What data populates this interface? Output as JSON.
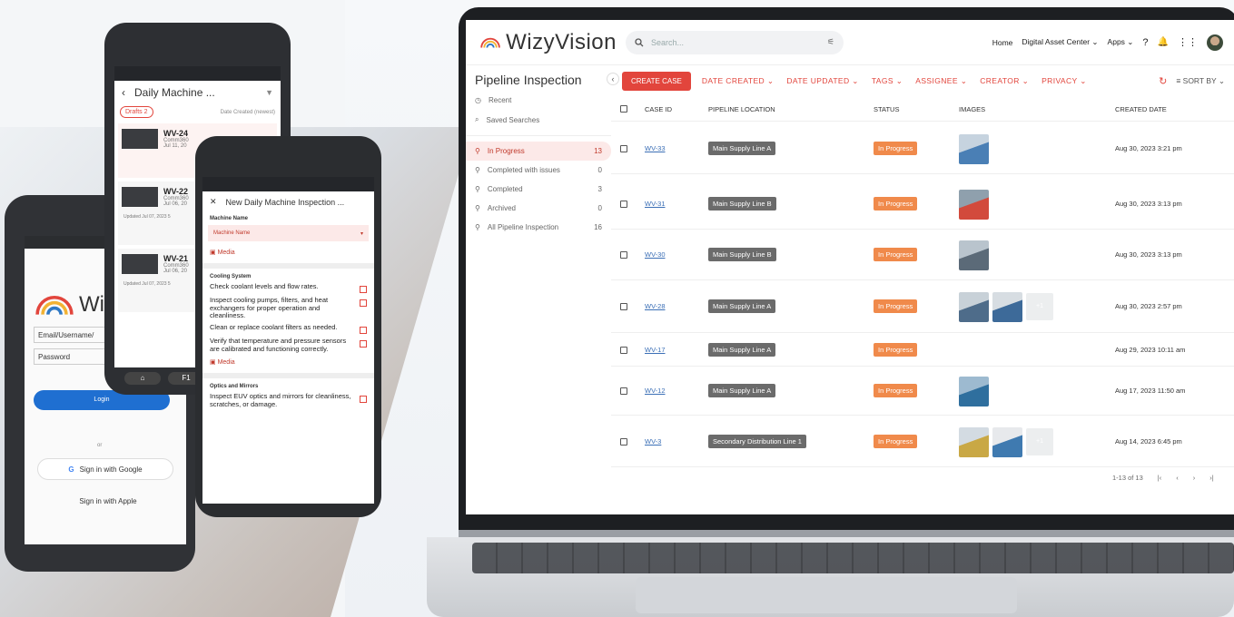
{
  "brand": {
    "name": "WizyVision"
  },
  "header": {
    "search_placeholder": "Search...",
    "nav": [
      "Home",
      "Digital Asset Center",
      "Apps"
    ]
  },
  "sidebar": {
    "title": "Pipeline Inspection",
    "links": [
      {
        "label": "Recent"
      },
      {
        "label": "Saved Searches"
      }
    ],
    "items": [
      {
        "label": "In Progress",
        "count": "13",
        "active": true
      },
      {
        "label": "Completed with issues",
        "count": "0"
      },
      {
        "label": "Completed",
        "count": "3"
      },
      {
        "label": "Archived",
        "count": "0"
      },
      {
        "label": "All Pipeline Inspection",
        "count": "16"
      }
    ]
  },
  "toolbar": {
    "create": "CREATE CASE",
    "filters": [
      "DATE CREATED",
      "DATE UPDATED",
      "TAGS",
      "ASSIGNEE",
      "CREATOR",
      "PRIVACY"
    ],
    "sort": "SORT BY"
  },
  "table": {
    "headers": [
      "CASE ID",
      "PIPELINE LOCATION",
      "STATUS",
      "IMAGES",
      "CREATED DATE"
    ],
    "rows": [
      {
        "id": "WV-33",
        "loc": "Main Supply Line A",
        "status": "In Progress",
        "date": "Aug 30, 2023 3:21 pm"
      },
      {
        "id": "WV-31",
        "loc": "Main Supply Line B",
        "status": "In Progress",
        "date": "Aug 30, 2023 3:13 pm"
      },
      {
        "id": "WV-30",
        "loc": "Main Supply Line B",
        "status": "In Progress",
        "date": "Aug 30, 2023 3:13 pm"
      },
      {
        "id": "WV-28",
        "loc": "Main Supply Line A",
        "status": "In Progress",
        "date": "Aug 30, 2023 2:57 pm",
        "more": "+1"
      },
      {
        "id": "WV-17",
        "loc": "Main Supply Line A",
        "status": "In Progress",
        "date": "Aug 29, 2023 10:11 am"
      },
      {
        "id": "WV-12",
        "loc": "Main Supply Line A",
        "status": "In Progress",
        "date": "Aug 17, 2023 11:50 am"
      },
      {
        "id": "WV-3",
        "loc": "Secondary Distribution Line 1",
        "status": "In Progress",
        "date": "Aug 14, 2023 6:45 pm",
        "more": "+1"
      }
    ],
    "pager": "1-13 of 13"
  },
  "phone_login": {
    "brand": "Wiz",
    "email_placeholder": "Email/Username/",
    "password_placeholder": "Password",
    "login": "Login",
    "or": "or",
    "google": "Sign in with Google",
    "apple": "Sign in with Apple"
  },
  "phone_list": {
    "title": "Daily Machine ...",
    "drafts": "Drafts 2",
    "sort": "Date Created (newest)",
    "items": [
      {
        "id": "WV-24",
        "l1": "Comm360",
        "l2": "Jul 11, 20"
      },
      {
        "id": "WV-22",
        "l1": "Comm360",
        "l2": "Jul 06, 20",
        "updated": "Updated Jul 07, 2023 5"
      },
      {
        "id": "WV-21",
        "l1": "Comm360",
        "l2": "Jul 06, 20",
        "updated": "Updated Jul 07, 2023 5"
      }
    ],
    "key": "F1"
  },
  "phone_form": {
    "title": "New Daily Machine Inspection ...",
    "machine_label": "Machine Name",
    "machine_placeholder": "Machine Name",
    "media": "Media",
    "section1": "Cooling System",
    "checks1": [
      "Check coolant levels and flow rates.",
      "Inspect cooling pumps, filters, and heat exchangers for proper operation and cleanliness.",
      "Clean or replace coolant filters as needed.",
      "Verify that temperature and pressure sensors are calibrated and functioning correctly."
    ],
    "section2": "Optics and Mirrors",
    "checks2": [
      "Inspect EUV optics and mirrors for cleanliness, scratches, or damage."
    ]
  },
  "colors": {
    "accent": "#e2453c",
    "status": "#f08a4b",
    "link": "#3b6fb6"
  }
}
